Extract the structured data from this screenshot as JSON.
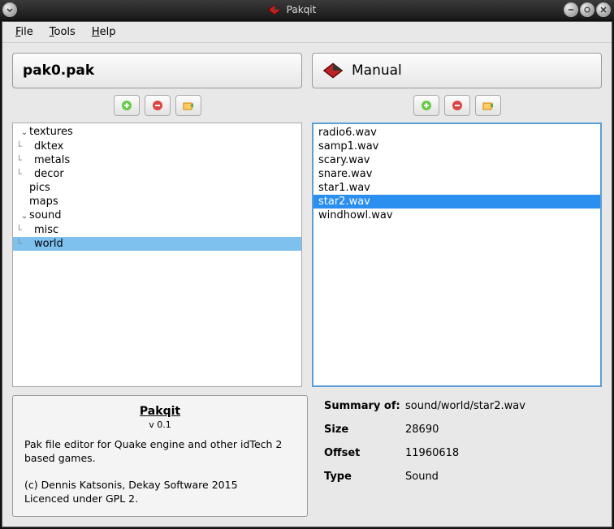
{
  "window": {
    "title": "Pakqit"
  },
  "menu": {
    "file": "File",
    "tools": "Tools",
    "help": "Help"
  },
  "left": {
    "title": "pak0.pak",
    "tree": [
      {
        "label": "textures",
        "depth": 0,
        "expandable": true,
        "expanded": true,
        "selected": false
      },
      {
        "label": "dktex",
        "depth": 1,
        "expandable": false,
        "selected": false
      },
      {
        "label": "metals",
        "depth": 1,
        "expandable": false,
        "selected": false
      },
      {
        "label": "decor",
        "depth": 1,
        "expandable": false,
        "selected": false
      },
      {
        "label": "pics",
        "depth": 0,
        "expandable": false,
        "selected": false
      },
      {
        "label": "maps",
        "depth": 0,
        "expandable": false,
        "selected": false
      },
      {
        "label": "sound",
        "depth": 0,
        "expandable": true,
        "expanded": true,
        "selected": false
      },
      {
        "label": "misc",
        "depth": 1,
        "expandable": false,
        "selected": false
      },
      {
        "label": "world",
        "depth": 1,
        "expandable": false,
        "selected": true
      }
    ]
  },
  "right": {
    "title": "Manual",
    "files": [
      {
        "name": "radio6.wav",
        "selected": false
      },
      {
        "name": "samp1.wav",
        "selected": false
      },
      {
        "name": "scary.wav",
        "selected": false
      },
      {
        "name": "snare.wav",
        "selected": false
      },
      {
        "name": "star1.wav",
        "selected": false
      },
      {
        "name": "star2.wav",
        "selected": true
      },
      {
        "name": "windhowl.wav",
        "selected": false
      }
    ]
  },
  "about": {
    "title": "Pakqit",
    "version": "v 0.1",
    "desc": "Pak file editor for Quake engine and other idTech 2 based games.",
    "copyright": "(c) Dennis Katsonis, Dekay Software 2015",
    "license": "Licenced under GPL 2."
  },
  "summary": {
    "heading_label": "Summary of:",
    "heading_value": "sound/world/star2.wav",
    "rows": [
      {
        "label": "Size",
        "value": "28690"
      },
      {
        "label": "Offset",
        "value": "11960618"
      },
      {
        "label": "Type",
        "value": "Sound"
      }
    ]
  },
  "icons": {
    "add": "add-icon",
    "remove": "remove-icon",
    "export": "export-icon"
  }
}
